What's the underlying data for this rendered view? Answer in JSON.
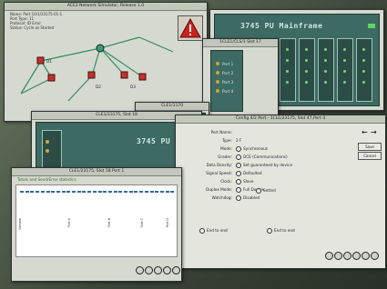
{
  "windows": {
    "simulator": {
      "title": "ACE2 Network Simulator, Release 1.0",
      "meta": [
        "Name: Port 10/1/23175-01-1",
        "Port Type: 11",
        "Protocol: ID  Error",
        "Status: Cycle as Started"
      ],
      "node_labels": [
        "D1",
        "D2",
        "D3"
      ]
    },
    "chassis_left": {
      "title": "CLE1/23175, Slot 18",
      "label": "3745 PU Mainframe"
    },
    "chassis_small": {
      "title": "CLE1/1170"
    },
    "chassis_right": {
      "label": "3745 PU Mainframe"
    },
    "slot_window": {
      "title": "1CLE1/CLS/1 Slot 17",
      "port_labels": [
        "Port 1",
        "Port 2",
        "Port 3",
        "Port 4"
      ]
    },
    "config_port": {
      "title": "Config 4/2 Port - 1CLE/23175, Slot 47,Port 4",
      "fields": [
        {
          "label": "Port Name:",
          "value": ""
        },
        {
          "label": "Type:",
          "value": "2 F"
        },
        {
          "label": "Mode:",
          "value": "Synchronous"
        },
        {
          "label": "Grader:",
          "value": "DCE (Communications)"
        },
        {
          "label": "Data Density:",
          "value": "Set guaranteed by device"
        },
        {
          "label": "Signal Speed:",
          "value": "Defaulted"
        },
        {
          "label": "Clock:",
          "value": "Slave"
        },
        {
          "label": "Duplex Mode:",
          "value": "Full Duplex"
        },
        {
          "label": "Watchdog:",
          "value": "Disabled"
        }
      ],
      "clock_alt": "Setted",
      "end_options": [
        "End to end",
        "End to end"
      ],
      "buttons": [
        "Save",
        "Cancel"
      ]
    },
    "traffic": {
      "title": "CLE1/23175, Slot 18 Port 1",
      "header": "Totals and Send/Error statistics",
      "columns": [
        "Sample",
        "Port A",
        "Port B",
        "Port C",
        "Port D"
      ]
    }
  },
  "icons": {
    "warning": "warning-triangle-icon",
    "footer": [
      "stop-icon",
      "help-icon",
      "reload-icon",
      "print-icon",
      "info-icon",
      "close-icon"
    ]
  },
  "colors": {
    "chassis": "#3d6a62",
    "window_bg": "#d6d9cf",
    "warning": "#c8221c"
  }
}
